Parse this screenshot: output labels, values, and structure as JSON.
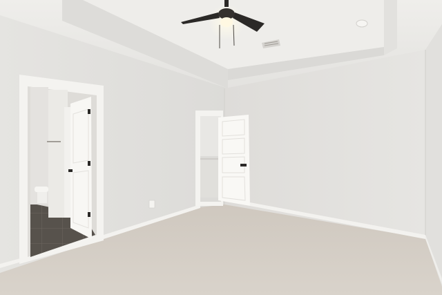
{
  "scene": {
    "subject": "empty-bedroom",
    "colors": {
      "wall": "#e7e6e3",
      "wall_shade": "#dcdad7",
      "ceiling": "#ecebe8",
      "carpet": "#d3ccc3",
      "trim": "#f4f3f0",
      "door": "#f7f6f3",
      "tile": "#55504a",
      "fan_blade": "#2a2826",
      "light": "#fff9e6"
    }
  }
}
